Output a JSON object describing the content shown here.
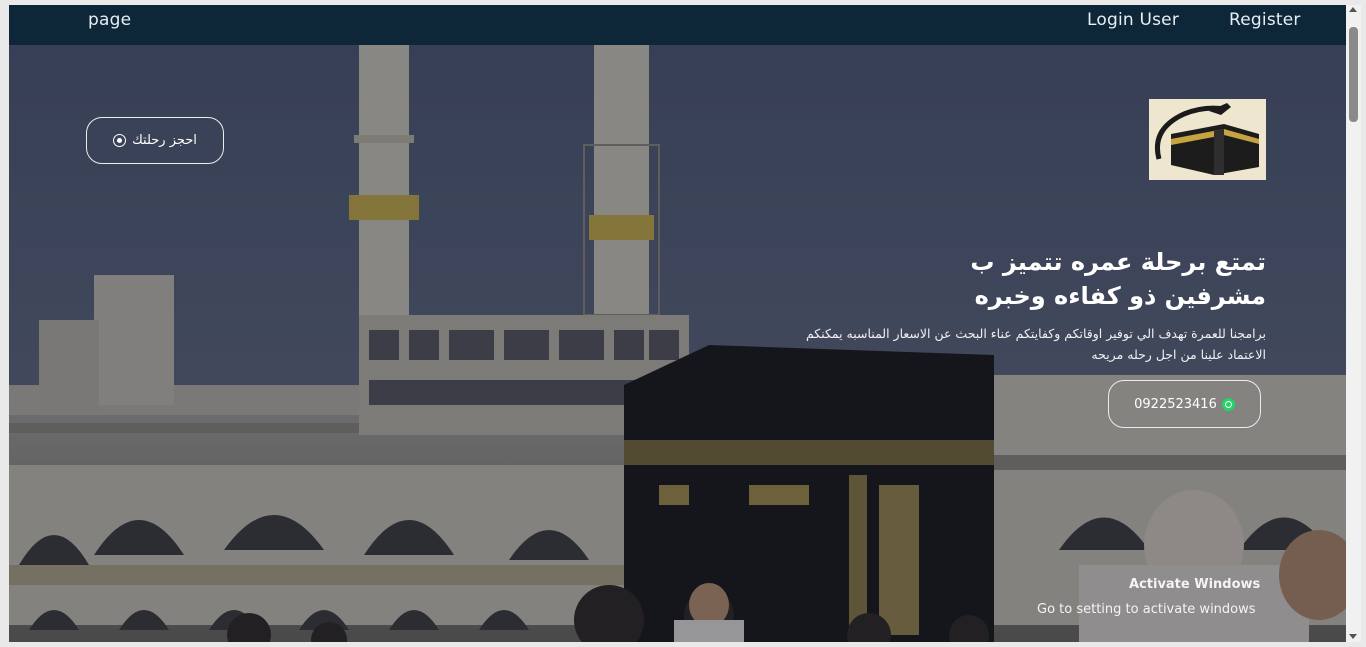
{
  "navbar": {
    "page_label": "page",
    "login_label": "Login User",
    "register_label": "Register"
  },
  "hero": {
    "book_button_label": "احجز رحلتك",
    "headline_line1": "تمتع برحلة عمره تتميز ب",
    "headline_line2": "مشرفين ذو كفاءه وخبره",
    "description_line1": "برامجنا للعمرة تهدف الي توفير اوقاتكم وكفايتكم عناء البحث عن الاسعار المناسبه يمكنكم",
    "description_line2": "الاعتماد علينا من اجل رحله مريحه",
    "phone": "0922523416",
    "phone_icon": "whatsapp-icon",
    "book_icon": "circle-dot-icon"
  },
  "watermark": {
    "title": "Activate Windows",
    "subtitle": "Go to setting to activate windows"
  },
  "colors": {
    "navbar": "#0d2738",
    "whatsapp": "#25d366"
  }
}
